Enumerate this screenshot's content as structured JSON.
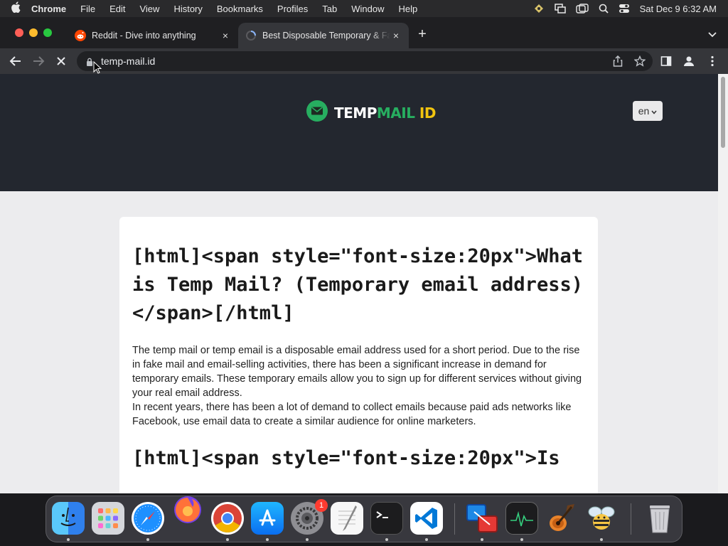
{
  "menubar": {
    "app_name": "Chrome",
    "items": [
      "File",
      "Edit",
      "View",
      "History",
      "Bookmarks",
      "Profiles",
      "Tab",
      "Window",
      "Help"
    ],
    "clock": "Sat Dec 9  6:32 AM"
  },
  "tabs": [
    {
      "title": "Reddit - Dive into anything",
      "favicon": "reddit-icon",
      "active": false,
      "close": "×"
    },
    {
      "title": "Best Disposable Temporary & Fake Email",
      "favicon": "loading-icon",
      "active": true,
      "close": "×"
    }
  ],
  "new_tab_label": "+",
  "omnibox": {
    "url": "temp-mail.id"
  },
  "site": {
    "logo": {
      "part1": "TEMP",
      "part2": "MAIL",
      "part3": " ID"
    },
    "language": "en"
  },
  "article": {
    "heading1": "[html]<span style=\"font-size:20px\">What is Temp Mail? (Temporary email address)</span>[/html]",
    "paragraph1": "The temp mail or temp email is a disposable email address used for a short period. Due to the rise in fake mail and email-selling activities, there has been a significant increase in demand for temporary emails. These temporary emails allow you to sign up for different services without giving your real email address.",
    "paragraph2": "In recent years, there has been a lot of demand to collect emails because paid ads networks like Facebook, use email data to create a similar audience for online marketers.",
    "heading2": "[html]<span style=\"font-size:20px\">Is"
  },
  "dock": {
    "apps": [
      "finder-icon",
      "launchpad-icon",
      "safari-icon",
      "firefox-icon",
      "chrome-icon",
      "app-store-icon",
      "system-settings-icon",
      "textedit-icon",
      "terminal-icon",
      "vscode-icon",
      "screen-sharing-icon",
      "activity-monitor-icon",
      "garageband-icon",
      "bee-app-icon",
      "trash-icon"
    ],
    "settings_badge": "1"
  },
  "colors": {
    "site_header": "#23272f",
    "logo_green": "#27ae60",
    "logo_yellow": "#f1c40f",
    "page_bg": "#ececee"
  }
}
